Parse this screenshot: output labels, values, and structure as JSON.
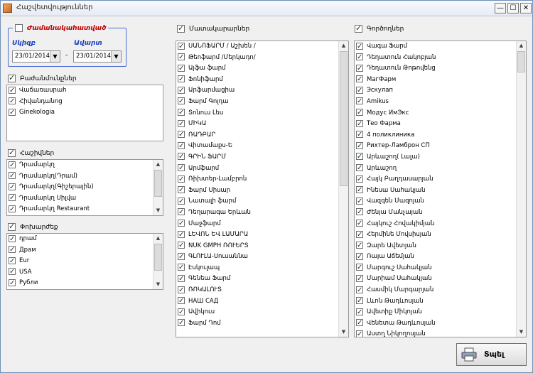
{
  "window": {
    "title": "Հաշվետվություններ",
    "min": "—",
    "max": "☐",
    "close": "✕"
  },
  "period": {
    "checkbox_label": "Ժամանակահատված",
    "from_label": "Սկիզբ",
    "to_label": "Ավարտ",
    "from_value": "23/01/2014",
    "to_value": "23/01/2014",
    "dash": "-"
  },
  "departments": {
    "label": "Բաժանմունքներ",
    "items": [
      "Վաճառասրահ",
      "Հիվանդանոց",
      "Ginekologia"
    ]
  },
  "accounts": {
    "label": "Հաշիվներ",
    "items": [
      "Դրամարկղ",
      "Դրամարկղ(Դրամ)",
      "Դրամարկղ(Գիշերային)",
      "Դրամարկղ Սիլվա",
      "Դրամարկղ Restaurant"
    ]
  },
  "currencies": {
    "label": "Փոխարժեք",
    "items": [
      "դրամ",
      "Драм",
      "Eur",
      "USA",
      "Рубли"
    ]
  },
  "suppliers": {
    "label": "Մատակարարներ",
    "items": [
      "ՍԱՆՈՖԱՐՄ / Աշխեն /",
      "Թեոֆարմ /Մերկադո/",
      "Այֆա ֆարմ",
      "Ֆոնիֆարմ",
      "Արֆարմացիա",
      "Ֆարմ Գոլդա",
      "Տոնուս Լես",
      "ՄԻԿԱ",
      "ՌԱԴԲԱՐ",
      "Վիտամաքս-Ե",
      "ԳՐԻՆ ՖԱՐՄ",
      "Արմֆարմ",
      "Ռիխտեր-Լամբրոն",
      "Ֆարմ Սիսար",
      "Նատալի ֆարմ",
      "Դեղարագա Երևան",
      "Մաջֆարմ",
      "ԼԵՎՈՆ ԵՎ ԼԱՄԱՐԱ",
      "NUK GMPH ՌՈՒԵՐՏ",
      "ԳԼՈՒԼԱ-Սուսաննա",
      "Էսկուլապ",
      "Գենեա Ֆարմ",
      "ՌՈԿԱԼՈՒՏ",
      "НАШ САД",
      "Ավիկուս",
      "Ֆարմ Դոմ"
    ]
  },
  "doctors": {
    "label": "Գործողներ",
    "items": [
      "Վագա Ֆարմ",
      "Դեղատուն Հակոբյան",
      "Դեղատուն Թոթովենց",
      "МагФарм",
      "Эскулап",
      "Amikus",
      "Модус ИмЭкс",
      "Тео Фарма",
      "4 поликлиника",
      "Рихтер-Ламброн СП",
      "Արևաշող( Լալա)",
      "Արևաշող",
      "Հայկ Բաղդասարյան",
      "Ինեսա Սահակյան",
      "Վազգեն Մազոյան",
      "Ժենյա Մանչայան",
      "Հայկուշ Հովակիմյան",
      "Հերմինե Մովսիսյան",
      "Զարե Ավետյան",
      "Ռայա Աճեմյան",
      "Մարգուշ Սահակյան",
      "Մարիամ Սահակյան",
      "Հասմիկ Մարգարյան",
      "Լևոն Թադևոսյան",
      "Ավետիք Միկոյան",
      "Վենետա Թադևոսյան",
      "Աստղ Նիկողոսյան"
    ]
  },
  "actions": {
    "print_label": "Տպել"
  }
}
